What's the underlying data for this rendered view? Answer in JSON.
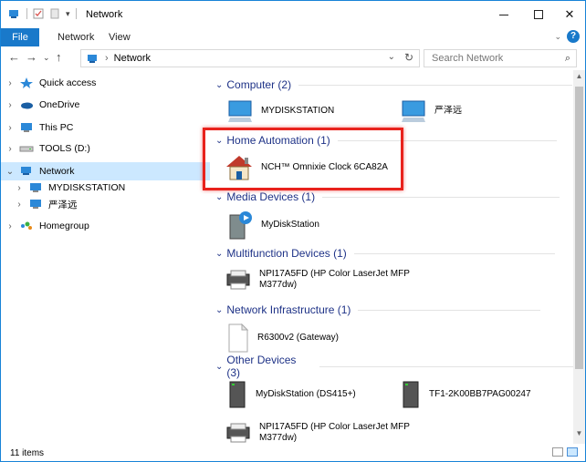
{
  "window": {
    "title": "Network"
  },
  "ribbon": {
    "file": "File",
    "tab_network": "Network",
    "tab_view": "View"
  },
  "address": {
    "crumb": "Network",
    "search_placeholder": "Search Network"
  },
  "nav": {
    "quick_access": "Quick access",
    "onedrive": "OneDrive",
    "this_pc": "This PC",
    "tools": "TOOLS (D:)",
    "network": "Network",
    "mydiskstation": "MYDISKSTATION",
    "yanzeyuan": "严泽远",
    "homegroup": "Homegroup"
  },
  "groups": {
    "computer": "Computer (2)",
    "home_automation": "Home Automation (1)",
    "media": "Media Devices (1)",
    "multifunction": "Multifunction Devices (1)",
    "infrastructure": "Network Infrastructure (1)",
    "other": "Other Devices (3)"
  },
  "items": {
    "computer_1": "MYDISKSTATION",
    "computer_2": "严泽远",
    "clock": "NCH™ Omnixie Clock 6CA82A",
    "media_1": "MyDiskStation",
    "printer_line1": "NPI17A5FD (HP Color LaserJet MFP",
    "printer_line2": "M377dw)",
    "router": "R6300v2 (Gateway)",
    "other_1": "MyDiskStation (DS415+)",
    "other_2": "TF1-2K00BB7PAG00247",
    "other_3_line1": "NPI17A5FD (HP Color LaserJet MFP",
    "other_3_line2": "M377dw)"
  },
  "status": {
    "count": "11 items"
  },
  "colors": {
    "accent": "#1979ca",
    "selection": "#cce8ff",
    "group_header": "#1e3287",
    "highlight": "#e8221c"
  }
}
